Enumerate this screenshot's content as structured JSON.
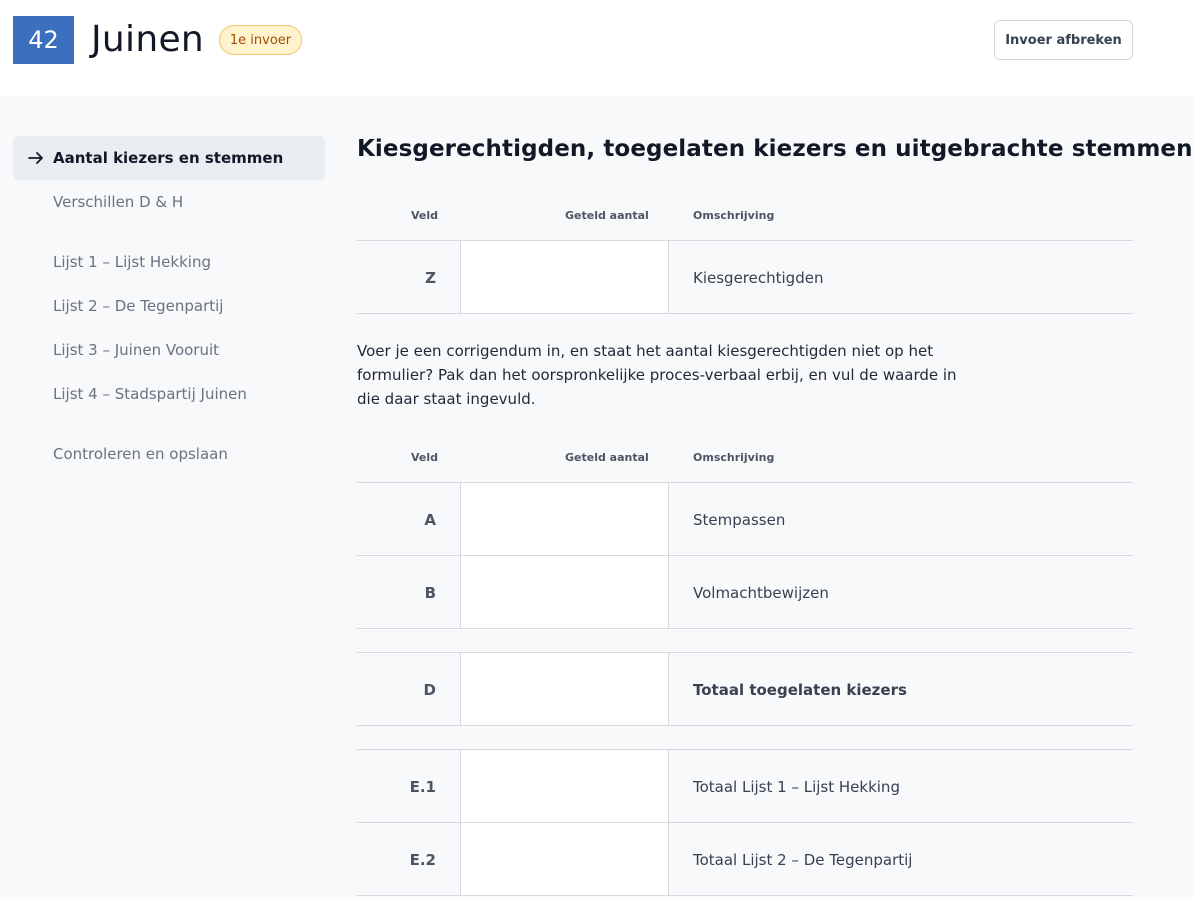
{
  "header": {
    "station_number": "42",
    "station_name": "Juinen",
    "badge": "1e invoer",
    "abort_label": "Invoer afbreken"
  },
  "sidebar": {
    "items": [
      {
        "label": "Aantal kiezers en stemmen",
        "active": true
      },
      {
        "label": "Verschillen D & H"
      },
      {
        "label": "Lijst 1 – Lijst Hekking"
      },
      {
        "label": "Lijst 2 – De Tegenpartij"
      },
      {
        "label": "Lijst 3 – Juinen Vooruit"
      },
      {
        "label": "Lijst 4 – Stadspartij Juinen"
      },
      {
        "label": "Controleren en opslaan"
      }
    ]
  },
  "main": {
    "title": "Kiesgerechtigden, toegelaten kiezers en uitgebrachte stemmen",
    "columns": {
      "field": "Veld",
      "count": "Geteld aantal",
      "description": "Omschrijving"
    },
    "table1": [
      {
        "code": "Z",
        "value": "",
        "description": "Kiesgerechtigden"
      }
    ],
    "info": "Voer je een corrigendum in, en staat het aantal kiesgerechtigden niet op het formulier? Pak dan het oorspronkelijke proces-verbaal erbij, en vul de waarde in die daar staat ingevuld.",
    "table2": [
      {
        "code": "A",
        "value": "",
        "description": "Stempassen"
      },
      {
        "code": "B",
        "value": "",
        "description": "Volmachtbewijzen"
      },
      {
        "code": "D",
        "value": "",
        "description": "Totaal toegelaten kiezers"
      },
      {
        "code": "E.1",
        "value": "",
        "description": "Totaal Lijst 1 – Lijst Hekking"
      },
      {
        "code": "E.2",
        "value": "",
        "description": "Totaal Lijst 2 – De Tegenpartij"
      }
    ]
  }
}
